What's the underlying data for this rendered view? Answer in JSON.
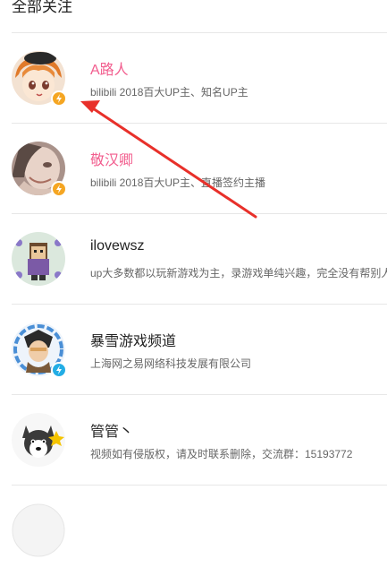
{
  "header": {
    "title": "全部关注"
  },
  "colors": {
    "pink": "#f25d8e",
    "dark": "#222222",
    "gray": "#666666",
    "gold": "#f5a623",
    "blue": "#23ade5",
    "arrow": "#e8302a"
  },
  "follows": [
    {
      "name": "A路人",
      "desc": "bilibili 2018百大UP主、知名UP主",
      "badge": "lightning-gold-icon"
    },
    {
      "name": "敬汉卿",
      "desc": "bilibili 2018百大UP主、直播签约主播",
      "badge": "lightning-gold-icon"
    },
    {
      "name": "ilovewsz",
      "desc": "up大多数都以玩新游戏为主，录游戏单纯兴趣，完全没有帮别人",
      "badge": ""
    },
    {
      "name": "暴雪游戏频道",
      "desc": "上海网之易网络科技发展有限公司",
      "badge": "lightning-blue-icon"
    },
    {
      "name": "管管丶",
      "desc": "视频如有侵版权，请及时联系删除，交流群：15193772",
      "badge": ""
    },
    {
      "name": "",
      "desc": "",
      "badge": ""
    }
  ]
}
